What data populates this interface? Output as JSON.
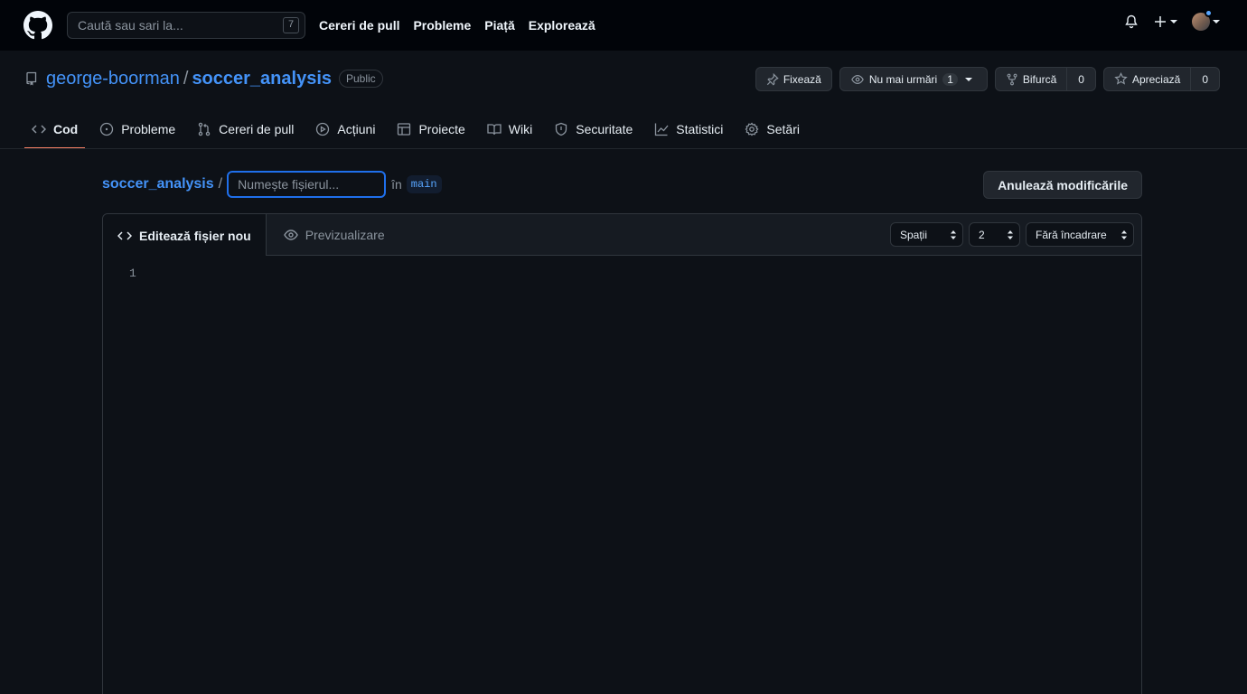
{
  "header": {
    "search_placeholder": "Caută sau sari la...",
    "search_shortcut": "7",
    "nav": [
      "Cereri de pull",
      "Probleme",
      "Piață",
      "Explorează"
    ]
  },
  "repo": {
    "owner": "george-boorman",
    "name": "soccer_analysis",
    "visibility": "Public",
    "pin_label": "Fixează",
    "watch_label": "Nu mai urmări",
    "watch_count": "1",
    "fork_label": "Bifurcă",
    "fork_count": "0",
    "star_label": "Apreciază",
    "star_count": "0"
  },
  "tabs": [
    {
      "label": "Cod",
      "icon": "code-icon",
      "active": true
    },
    {
      "label": "Probleme",
      "icon": "issue-icon"
    },
    {
      "label": "Cereri de pull",
      "icon": "pull-request-icon"
    },
    {
      "label": "Acțiuni",
      "icon": "play-icon"
    },
    {
      "label": "Proiecte",
      "icon": "table-icon"
    },
    {
      "label": "Wiki",
      "icon": "book-icon"
    },
    {
      "label": "Securitate",
      "icon": "shield-icon"
    },
    {
      "label": "Statistici",
      "icon": "graph-icon"
    },
    {
      "label": "Setări",
      "icon": "gear-icon"
    }
  ],
  "file": {
    "crumb": "soccer_analysis",
    "separator": "/",
    "filename_placeholder": "Numește fișierul...",
    "in_label": "în",
    "branch": "main",
    "cancel_label": "Anulează modificările"
  },
  "editor": {
    "edit_tab": "Editează fișier nou",
    "preview_tab": "Previzualizare",
    "indent_mode": "Spații",
    "indent_size": "2",
    "wrap_mode": "Fără încadrare",
    "line_number": "1"
  },
  "colors": {
    "accent": "#4493f8",
    "active_tab_underline": "#f78166",
    "focus_border": "#1f6feb",
    "background": "#0d1117"
  }
}
